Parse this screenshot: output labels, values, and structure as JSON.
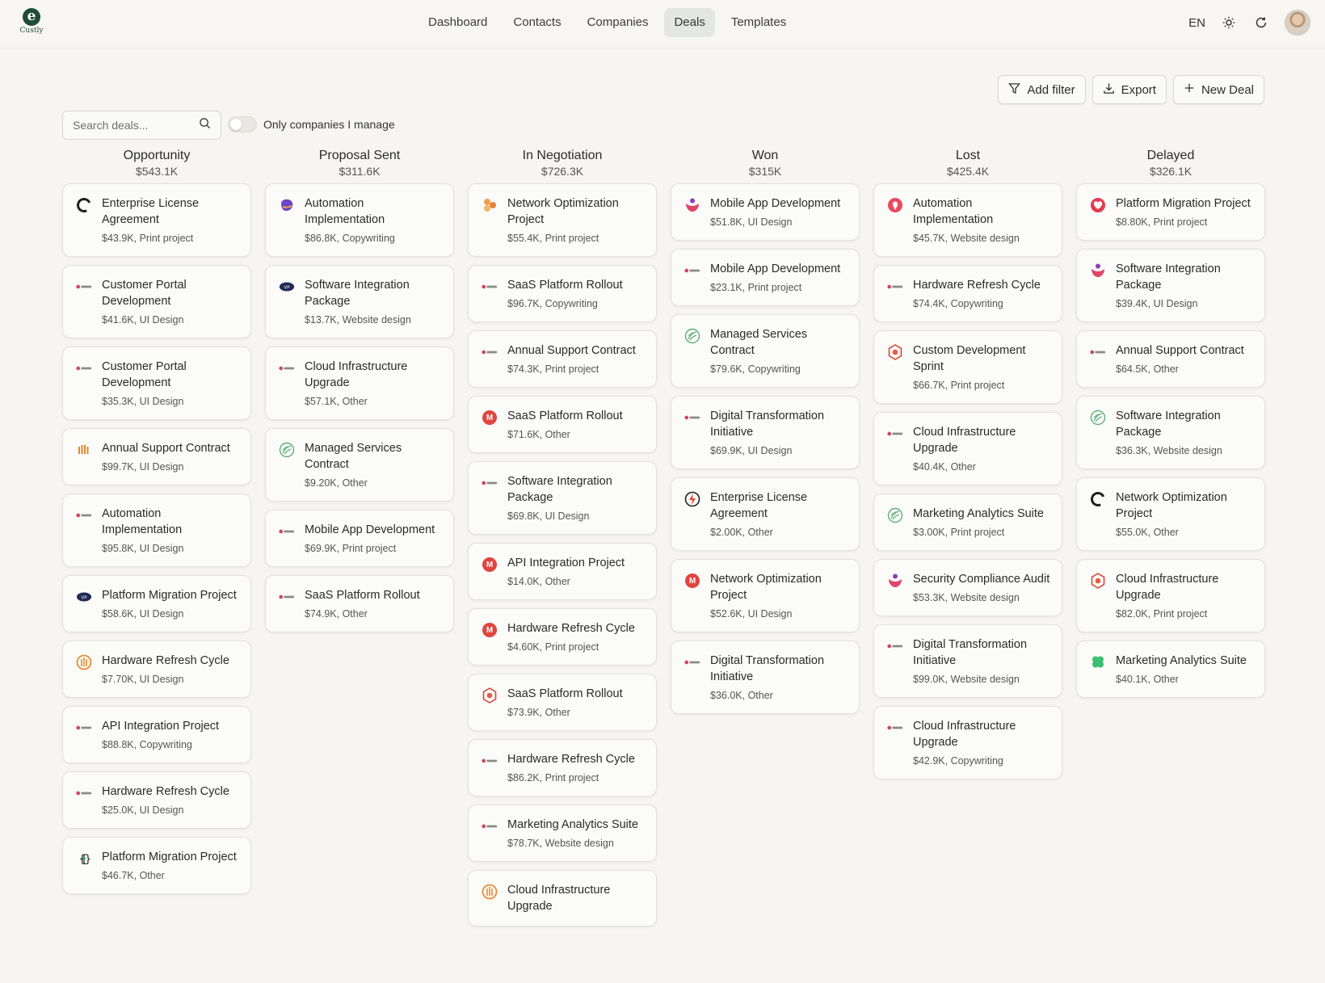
{
  "app": {
    "logo_text": "Custly"
  },
  "nav": [
    {
      "label": "Dashboard",
      "active": false
    },
    {
      "label": "Contacts",
      "active": false
    },
    {
      "label": "Companies",
      "active": false
    },
    {
      "label": "Deals",
      "active": true
    },
    {
      "label": "Templates",
      "active": false
    }
  ],
  "header": {
    "lang": "EN"
  },
  "toolbar": {
    "add_filter": "Add filter",
    "export": "Export",
    "new_deal": "New Deal"
  },
  "search": {
    "placeholder": "Search deals..."
  },
  "toggle": {
    "label": "Only companies I manage",
    "on": false
  },
  "columns": [
    {
      "title": "Opportunity",
      "total": "$543.1K",
      "cards": [
        {
          "title": "Enterprise License Agreement",
          "meta": "$43.9K, Print project",
          "icon": "ring-logo"
        },
        {
          "title": "Customer Portal Development",
          "meta": "$41.6K, UI Design",
          "icon": "wordmark-logo"
        },
        {
          "title": "Customer Portal Development",
          "meta": "$35.3K, UI Design",
          "icon": "wordmark-logo"
        },
        {
          "title": "Annual Support Contract",
          "meta": "$99.7K, UI Design",
          "icon": "bars-logo"
        },
        {
          "title": "Automation Implementation",
          "meta": "$95.8K, UI Design",
          "icon": "wordmark-logo"
        },
        {
          "title": "Platform Migration Project",
          "meta": "$58.6K, UI Design",
          "icon": "badge-logo"
        },
        {
          "title": "Hardware Refresh Cycle",
          "meta": "$7.70K, UI Design",
          "icon": "orange-circle-logo"
        },
        {
          "title": "API Integration Project",
          "meta": "$88.8K, Copywriting",
          "icon": "wordmark-logo"
        },
        {
          "title": "Hardware Refresh Cycle",
          "meta": "$25.0K, UI Design",
          "icon": "wordmark-logo"
        },
        {
          "title": "Platform Migration Project",
          "meta": "$46.7K, Other",
          "icon": "braces-logo"
        }
      ]
    },
    {
      "title": "Proposal Sent",
      "total": "$311.6K",
      "cards": [
        {
          "title": "Automation Implementation",
          "meta": "$86.8K, Copywriting",
          "icon": "purple-blob-logo"
        },
        {
          "title": "Software Integration Package",
          "meta": "$13.7K, Website design",
          "icon": "badge-logo"
        },
        {
          "title": "Cloud Infrastructure Upgrade",
          "meta": "$57.1K, Other",
          "icon": "wordmark-logo"
        },
        {
          "title": "Managed Services Contract",
          "meta": "$9.20K, Other",
          "icon": "green-leaf-logo"
        },
        {
          "title": "Mobile App Development",
          "meta": "$69.9K, Print project",
          "icon": "wordmark-logo"
        },
        {
          "title": "SaaS Platform Rollout",
          "meta": "$74.9K, Other",
          "icon": "wordmark-logo"
        }
      ]
    },
    {
      "title": "In Negotiation",
      "total": "$726.3K",
      "cards": [
        {
          "title": "Network Optimization Project",
          "meta": "$55.4K, Print project",
          "icon": "orange-hex-logo"
        },
        {
          "title": "SaaS Platform Rollout",
          "meta": "$96.7K, Copywriting",
          "icon": "wordmark-logo"
        },
        {
          "title": "Annual Support Contract",
          "meta": "$74.3K, Print project",
          "icon": "wordmark-logo"
        },
        {
          "title": "SaaS Platform Rollout",
          "meta": "$71.6K, Other",
          "icon": "red-m-logo"
        },
        {
          "title": "Software Integration Package",
          "meta": "$69.8K, UI Design",
          "icon": "wordmark-logo"
        },
        {
          "title": "API Integration Project",
          "meta": "$14.0K, Other",
          "icon": "red-m-logo"
        },
        {
          "title": "Hardware Refresh Cycle",
          "meta": "$4.60K, Print project",
          "icon": "red-m-logo"
        },
        {
          "title": "SaaS Platform Rollout",
          "meta": "$73.9K, Other",
          "icon": "red-hex-logo"
        },
        {
          "title": "Hardware Refresh Cycle",
          "meta": "$86.2K, Print project",
          "icon": "wordmark-logo"
        },
        {
          "title": "Marketing Analytics Suite",
          "meta": "$78.7K, Website design",
          "icon": "wordmark-logo"
        },
        {
          "title": "Cloud Infrastructure Upgrade",
          "meta": "",
          "icon": "orange-circle-logo"
        }
      ]
    },
    {
      "title": "Won",
      "total": "$315K",
      "cards": [
        {
          "title": "Mobile App Development",
          "meta": "$51.8K, UI Design",
          "icon": "people-logo"
        },
        {
          "title": "Mobile App Development",
          "meta": "$23.1K, Print project",
          "icon": "wordmark-logo"
        },
        {
          "title": "Managed Services Contract",
          "meta": "$79.6K, Copywriting",
          "icon": "green-leaf-logo"
        },
        {
          "title": "Digital Transformation Initiative",
          "meta": "$69.9K, UI Design",
          "icon": "wordmark-logo"
        },
        {
          "title": "Enterprise License Agreement",
          "meta": "$2.00K, Other",
          "icon": "bolt-logo"
        },
        {
          "title": "Network Optimization Project",
          "meta": "$52.6K, UI Design",
          "icon": "red-m-logo"
        },
        {
          "title": "Digital Transformation Initiative",
          "meta": "$36.0K, Other",
          "icon": "wordmark-logo"
        }
      ]
    },
    {
      "title": "Lost",
      "total": "$425.4K",
      "cards": [
        {
          "title": "Automation Implementation",
          "meta": "$45.7K, Website design",
          "icon": "pin-logo"
        },
        {
          "title": "Hardware Refresh Cycle",
          "meta": "$74.4K, Copywriting",
          "icon": "wordmark-logo"
        },
        {
          "title": "Custom Development Sprint",
          "meta": "$66.7K, Print project",
          "icon": "red-hex-logo"
        },
        {
          "title": "Cloud Infrastructure Upgrade",
          "meta": "$40.4K, Other",
          "icon": "wordmark-logo"
        },
        {
          "title": "Marketing Analytics Suite",
          "meta": "$3.00K, Print project",
          "icon": "green-leaf-logo"
        },
        {
          "title": "Security Compliance Audit",
          "meta": "$53.3K, Website design",
          "icon": "people-logo"
        },
        {
          "title": "Digital Transformation Initiative",
          "meta": "$99.0K, Website design",
          "icon": "wordmark-logo"
        },
        {
          "title": "Cloud Infrastructure Upgrade",
          "meta": "$42.9K, Copywriting",
          "icon": "wordmark-logo"
        }
      ]
    },
    {
      "title": "Delayed",
      "total": "$326.1K",
      "cards": [
        {
          "title": "Platform Migration Project",
          "meta": "$8.80K, Print project",
          "icon": "heart-logo"
        },
        {
          "title": "Software Integration Package",
          "meta": "$39.4K, UI Design",
          "icon": "people-logo"
        },
        {
          "title": "Annual Support Contract",
          "meta": "$64.5K, Other",
          "icon": "wordmark-logo"
        },
        {
          "title": "Software Integration Package",
          "meta": "$36.3K, Website design",
          "icon": "green-leaf-logo"
        },
        {
          "title": "Network Optimization Project",
          "meta": "$55.0K, Other",
          "icon": "ring-logo"
        },
        {
          "title": "Cloud Infrastructure Upgrade",
          "meta": "$82.0K, Print project",
          "icon": "red-hex-logo"
        },
        {
          "title": "Marketing Analytics Suite",
          "meta": "$40.1K, Other",
          "icon": "clover-logo"
        }
      ]
    }
  ]
}
